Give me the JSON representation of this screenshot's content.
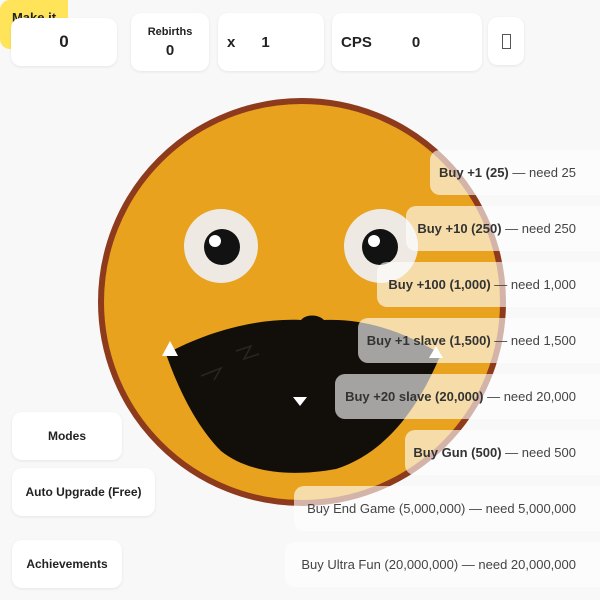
{
  "stats": {
    "score": "0",
    "rebirths_label": "Rebirths",
    "rebirths": "0",
    "multiplier_label": "x",
    "multiplier": "1",
    "cps_label": "CPS",
    "cps": "0"
  },
  "toolbar": {
    "icon_button": "unknown-glyph-icon",
    "make_nice_label": "Make it nice"
  },
  "shop": [
    {
      "label": "Buy +1 (25)",
      "need": "need 25"
    },
    {
      "label": "Buy +10 (250)",
      "need": "need 250"
    },
    {
      "label": "Buy +100 (1,000)",
      "need": "need 1,000"
    },
    {
      "label": "Buy +1 slave (1,500)",
      "need": "need 1,500"
    },
    {
      "label": "Buy +20 slave (20,000)",
      "need": "need 20,000"
    },
    {
      "label": "Buy Gun (500)",
      "need": "need 500"
    },
    {
      "label": "Buy End Game (5,000,000)",
      "need": "need 5,000,000"
    },
    {
      "label": "Buy Ultra Fun (20,000,000)",
      "need": "need 20,000,000"
    }
  ],
  "side_buttons": {
    "modes": "Modes",
    "auto_upgrade": "Auto Upgrade (Free)",
    "achievements": "Achievements"
  },
  "colors": {
    "face": "#e8a21d",
    "face_border": "#8e3a1c",
    "mouth": "#120f0a",
    "accent": "#ffe45a"
  }
}
